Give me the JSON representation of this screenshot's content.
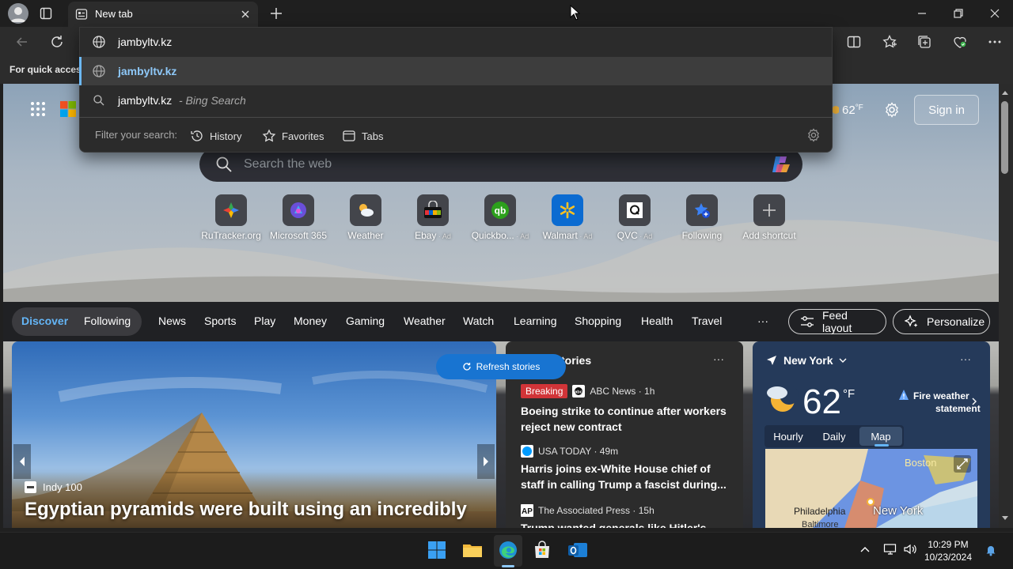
{
  "browser": {
    "tab_title": "New tab",
    "favbar_text": "For quick access",
    "address_value": "jambyltv.kz"
  },
  "omnibox": {
    "suggestion_url": "jambyltv.kz",
    "suggestion_search": "jambyltv.kz",
    "suggestion_search_suffix": " - Bing Search",
    "filter_label": "Filter your search:",
    "filters": [
      "History",
      "Favorites",
      "Tabs"
    ]
  },
  "page": {
    "temperature": "62",
    "temp_unit": "°F",
    "signin": "Sign in",
    "search_placeholder": "Search the web"
  },
  "shortcuts": [
    {
      "label": "RuTracker.org",
      "ad": "",
      "icon": "rutracker-icon"
    },
    {
      "label": "Microsoft 365",
      "ad": "",
      "icon": "microsoft365-icon"
    },
    {
      "label": "Weather",
      "ad": "",
      "icon": "weather-icon"
    },
    {
      "label": "Ebay",
      "ad": " · Ad",
      "icon": "ebay-icon"
    },
    {
      "label": "Quickbo...",
      "ad": " · Ad",
      "icon": "quickbooks-icon"
    },
    {
      "label": "Walmart",
      "ad": " · Ad",
      "icon": "walmart-icon"
    },
    {
      "label": "QVC",
      "ad": " · Ad",
      "icon": "qvc-icon"
    },
    {
      "label": "Following",
      "ad": "",
      "icon": "following-icon"
    },
    {
      "label": "Add shortcut",
      "ad": "",
      "icon": "plus-icon"
    }
  ],
  "feed_nav": {
    "discover": "Discover",
    "following": "Following",
    "items": [
      "News",
      "Sports",
      "Play",
      "Money",
      "Gaming",
      "Weather",
      "Watch",
      "Learning",
      "Shopping",
      "Health",
      "Travel"
    ],
    "more": "···",
    "feed_layout": "Feed layout",
    "personalize": "Personalize"
  },
  "hero": {
    "source": "Indy 100",
    "title": "Egyptian pyramids were built using an incredibly"
  },
  "stories": {
    "header_fragment": "tories",
    "refresh": "Refresh stories",
    "breaking": "Breaking",
    "items": [
      {
        "source": "ABC News · 1h",
        "title": "Boeing strike to continue after workers reject new contract"
      },
      {
        "source": "USA TODAY · 49m",
        "title": "Harris joins ex-White House chief of staff in calling Trump a fascist during..."
      },
      {
        "source": "The Associated Press · 15h",
        "title": "Trump wanted generals like Hitler's and"
      }
    ]
  },
  "weather": {
    "location": "New York",
    "temp": "62",
    "unit": "°F",
    "alert_line1": "Fire weather",
    "alert_line2": "statement",
    "tabs": [
      "Hourly",
      "Daily",
      "Map"
    ],
    "active_tab": "Map",
    "map_labels": [
      "Boston",
      "Philadelphia",
      "New York",
      "Baltimore"
    ]
  },
  "taskbar": {
    "time": "10:29 PM",
    "date": "10/23/2024"
  }
}
